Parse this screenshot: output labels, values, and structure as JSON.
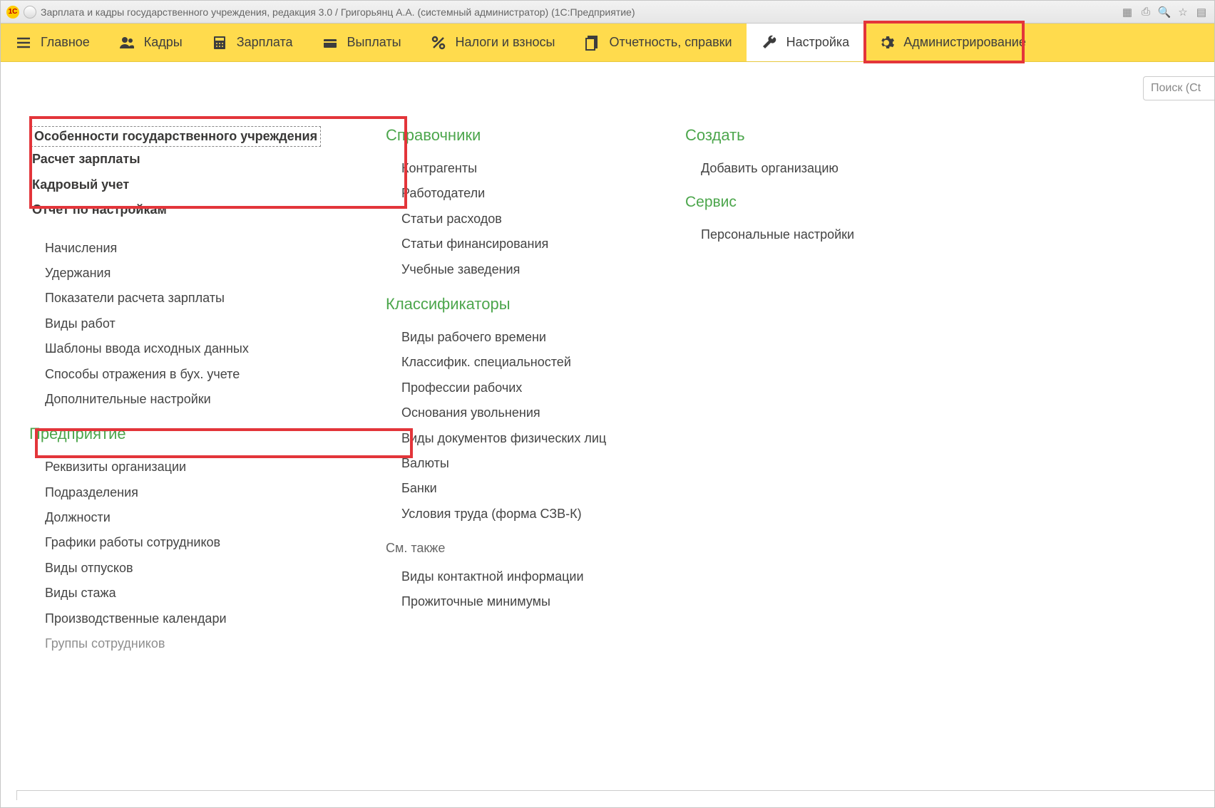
{
  "titlebar": {
    "app_logo": "1C",
    "title": "Зарплата и кадры государственного учреждения, редакция 3.0 / Григорьянц А.А. (системный администратор)  (1С:Предприятие)"
  },
  "nav": {
    "items": [
      {
        "label": "Главное"
      },
      {
        "label": "Кадры"
      },
      {
        "label": "Зарплата"
      },
      {
        "label": "Выплаты"
      },
      {
        "label": "Налоги и взносы"
      },
      {
        "label": "Отчетность, справки"
      },
      {
        "label": "Настройка",
        "active": true
      },
      {
        "label": "Администрирование"
      }
    ]
  },
  "search": {
    "placeholder": "Поиск (Ct"
  },
  "col1": {
    "top_bold": [
      "Особенности государственного учреждения",
      "Расчет зарплаты",
      "Кадровый учет",
      "Отчет по настройкам"
    ],
    "mid": [
      "Начисления",
      "Удержания",
      "Показатели расчета зарплаты",
      "Виды работ",
      "Шаблоны ввода исходных данных",
      "Способы отражения в бух. учете",
      "Дополнительные настройки"
    ],
    "enterprise_head": "Предприятие",
    "enterprise": [
      "Реквизиты организации",
      "Подразделения",
      "Должности",
      "Графики работы сотрудников",
      "Виды отпусков",
      "Виды стажа",
      "Производственные календари",
      "Группы сотрудников"
    ]
  },
  "col2": {
    "dir_head": "Справочники",
    "dir": [
      "Контрагенты",
      "Работодатели",
      "Статьи расходов",
      "Статьи финансирования",
      "Учебные заведения"
    ],
    "class_head": "Классификаторы",
    "class": [
      "Виды рабочего времени",
      "Классифик. специальностей",
      "Профессии рабочих",
      "Основания увольнения",
      "Виды документов физических лиц",
      "Валюты",
      "Банки",
      "Условия труда (форма СЗВ-К)"
    ],
    "seealso_head": "См. также",
    "seealso": [
      "Виды контактной информации",
      "Прожиточные минимумы"
    ]
  },
  "col3": {
    "create_head": "Создать",
    "create": [
      "Добавить организацию"
    ],
    "service_head": "Сервис",
    "service": [
      "Персональные настройки"
    ]
  }
}
